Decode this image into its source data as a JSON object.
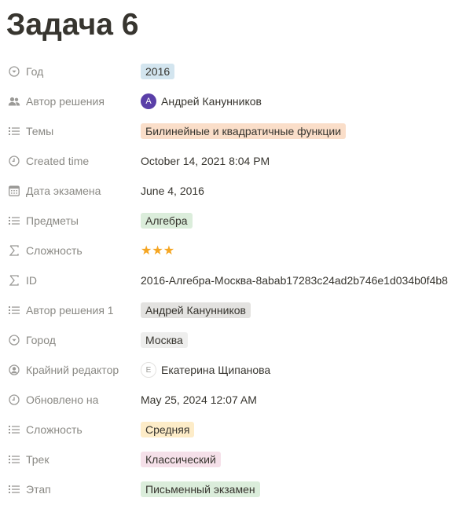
{
  "page": {
    "title": "Задача 6"
  },
  "properties": [
    {
      "name": "Год",
      "icon": "select-icon",
      "type": "tag",
      "color": "blue",
      "value": "2016"
    },
    {
      "name": "Автор решения",
      "icon": "people-icon",
      "type": "person",
      "avatar": "А",
      "avatar_style": "purple",
      "value": "Андрей Канунников"
    },
    {
      "name": "Темы",
      "icon": "list-icon",
      "type": "tag",
      "color": "orange",
      "value": "Билинейные и квадратичные функции"
    },
    {
      "name": "Created time",
      "icon": "clock-icon",
      "type": "text",
      "value": "October 14, 2021 8:04 PM"
    },
    {
      "name": "Дата экзамена",
      "icon": "calendar-icon",
      "type": "text",
      "value": "June 4, 2016"
    },
    {
      "name": "Предметы",
      "icon": "list-icon",
      "type": "tag",
      "color": "green",
      "value": "Алгебра"
    },
    {
      "name": "Сложность",
      "icon": "sigma-icon",
      "type": "stars",
      "value": "★★★"
    },
    {
      "name": "ID",
      "icon": "sigma-icon",
      "type": "text",
      "value": "2016-Алгебра-Москва-8abab17283c24ad2b746e1d034b0f4b8"
    },
    {
      "name": "Автор решения 1",
      "icon": "list-icon",
      "type": "tag",
      "color": "gray",
      "value": "Андрей Канунников"
    },
    {
      "name": "Город",
      "icon": "select-icon",
      "type": "tag",
      "color": "gray-light",
      "value": "Москва"
    },
    {
      "name": "Крайний редактор",
      "icon": "person-icon",
      "type": "person",
      "avatar": "Е",
      "avatar_style": "outline",
      "value": "Екатерина Щипанова"
    },
    {
      "name": "Обновлено на",
      "icon": "clock-icon",
      "type": "text",
      "value": "May 25, 2024 12:07 AM"
    },
    {
      "name": "Сложность",
      "icon": "list-icon",
      "type": "tag",
      "color": "yellow",
      "value": "Средняя"
    },
    {
      "name": "Трек",
      "icon": "list-icon",
      "type": "tag",
      "color": "pink",
      "value": "Классический"
    },
    {
      "name": "Этап",
      "icon": "list-icon",
      "type": "tag",
      "color": "green",
      "value": "Письменный экзамен"
    }
  ],
  "colors": {
    "text": "#37352f",
    "muted": "#8a8984",
    "star": "#f5a623"
  }
}
